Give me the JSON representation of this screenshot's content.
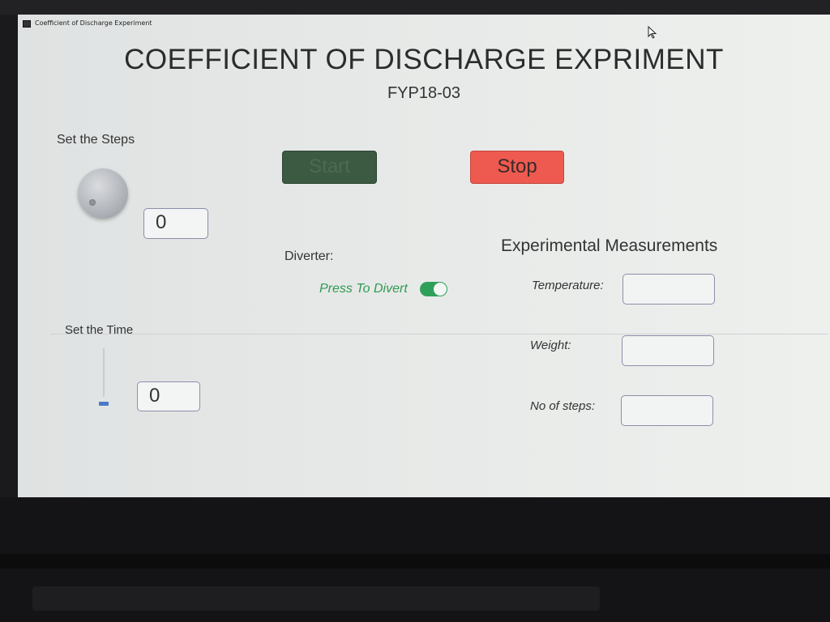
{
  "window": {
    "title": "Coefficient of Discharge Experiment"
  },
  "header": {
    "title": "COEFFICIENT OF DISCHARGE EXPRIMENT",
    "subtitle": "FYP18-03"
  },
  "steps": {
    "label": "Set the Steps",
    "value": "0"
  },
  "time": {
    "label": "Set the Time",
    "value": "0",
    "slider_level": 0
  },
  "controls": {
    "start_label": "Start",
    "stop_label": "Stop",
    "start_color": "#3c5a42",
    "stop_color": "#ee5a50"
  },
  "diverter": {
    "label": "Diverter:",
    "toggle_label": "Press To Divert",
    "toggle_on": true,
    "accent": "#2fa05a"
  },
  "measurements": {
    "heading": "Experimental Measurements",
    "fields": [
      {
        "label": "Temperature:",
        "value": ""
      },
      {
        "label": "Weight:",
        "value": ""
      },
      {
        "label": "No of steps:",
        "value": ""
      }
    ]
  },
  "icons": {
    "window": "app-window-icon",
    "cursor": "mouse-pointer-icon"
  }
}
